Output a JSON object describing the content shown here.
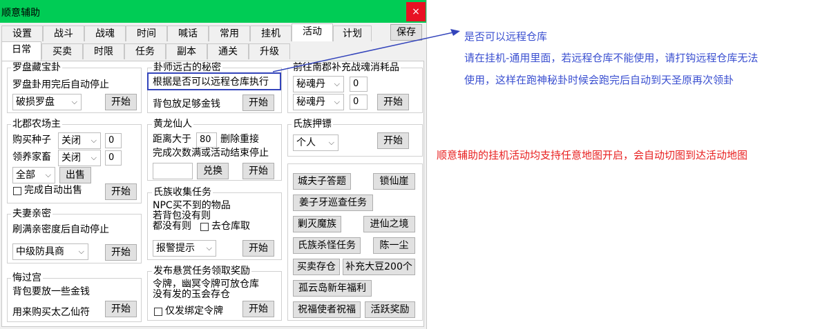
{
  "window": {
    "title": "顺意辅助",
    "close_glyph": "×"
  },
  "tabs_row1": [
    "设置",
    "战斗",
    "战魂",
    "时间",
    "喊话",
    "常用",
    "挂机",
    "活动",
    "计划"
  ],
  "tabs_row2": [
    "日常",
    "买卖",
    "时限",
    "任务",
    "副本",
    "通关",
    "升级"
  ],
  "save_button": "保存",
  "luopan": {
    "title": "罗盘藏宝卦",
    "desc": "罗盘卦用完后自动停止",
    "select": "破损罗盘",
    "start": "开始"
  },
  "guashi": {
    "title": "卦师远古的秘密",
    "desc": "根据是否可以远程仓库执行",
    "desc2": "背包放足够金钱",
    "start": "开始"
  },
  "nanjun": {
    "title": "前往南郡补充战魂消耗品",
    "select1": "秘魂丹",
    "val1": "0",
    "select2": "秘魂丹",
    "val2": "0",
    "start": "开始"
  },
  "beijun": {
    "title": "北郡农场主",
    "buy_label": "购买种子",
    "buy_select": "关闭",
    "buy_val": "0",
    "raise_label": "领养家畜",
    "raise_select": "关闭",
    "raise_val": "0",
    "all_select": "全部",
    "sell": "出售",
    "auto_sell": "完成自动出售",
    "start": "开始"
  },
  "huanglong": {
    "title": "黄龙仙人",
    "dist_label": "距离大于",
    "dist_val": "80",
    "dist_suffix": "删除重接",
    "desc": "完成次数满或活动结束停止",
    "exchange": "兑换",
    "start": "开始"
  },
  "shizu_shouji": {
    "title": "氏族收集任务",
    "line1": "NPC买不到的物品",
    "line2": "若背包没有则",
    "line3": "都没有则",
    "check_label": "去仓库取",
    "select": "报警提示",
    "start": "开始"
  },
  "shizu_yabiao": {
    "title": "氏族押镖",
    "select": "个人",
    "start": "开始"
  },
  "fuqi": {
    "title": "夫妻亲密",
    "desc": "刷满亲密度后自动停止",
    "select": "中级防具商",
    "start": "开始"
  },
  "xuanshang": {
    "title": "发布悬赏任务领取奖励",
    "line1": "令牌，幽冥令牌可放仓库",
    "line2": "没有发的玉会存仓",
    "check_label": "仅发绑定令牌",
    "start": "开始"
  },
  "huiguo": {
    "title": "悔过宫",
    "line1": "背包要放一些金钱",
    "line2": "用来购买太乙仙符",
    "start": "开始"
  },
  "activities": [
    "城夫子答题",
    "锁仙崖",
    "姜子牙巡查任务",
    "剿灭魔族",
    "进仙之境",
    "氏族杀怪任务",
    "陈一尘",
    "买卖存仓",
    "补充大豆200个",
    "孤云岛新年福利",
    "祝福使者祝福",
    "活跃奖励"
  ],
  "annotations": {
    "blue_title": "是否可以远程仓库",
    "blue_line1": "请在挂机-通用里面，若远程仓库不能使用，请打钩远程仓库无法",
    "blue_line2": "使用，这样在跑神秘卦时候会跑完后自动到天圣原再次领卦",
    "red_line": "顺意辅助的挂机活动均支持任意地图开启，会自动切图到达活动地图",
    "blue_color": "#3a4fd0",
    "red_color": "#e82020"
  }
}
